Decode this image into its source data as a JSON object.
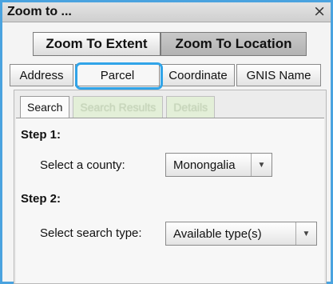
{
  "window": {
    "title": "Zoom to ...",
    "close_glyph": "×"
  },
  "zoom_buttons": [
    {
      "label": "Zoom To Extent",
      "active": false
    },
    {
      "label": "Zoom To Location",
      "active": true
    }
  ],
  "tabs": [
    {
      "label": "Address"
    },
    {
      "label": "Parcel",
      "selected": true
    },
    {
      "label": "Coordinate"
    },
    {
      "label": "GNIS Name"
    }
  ],
  "inner_tabs": [
    {
      "label": "Search",
      "active": true
    },
    {
      "label": "Search Results",
      "active": false
    },
    {
      "label": "Details",
      "active": false
    }
  ],
  "step1": {
    "heading": "Step 1:",
    "label": "Select a county:",
    "value": "Monongalia"
  },
  "step2": {
    "heading": "Step 2:",
    "label": "Select search type:",
    "value": "Available type(s)"
  },
  "icons": {
    "dropdown": "chevron-down-icon",
    "close": "close-icon"
  },
  "colors": {
    "highlight": "#31a4e8",
    "frame": "#4aa3df"
  }
}
